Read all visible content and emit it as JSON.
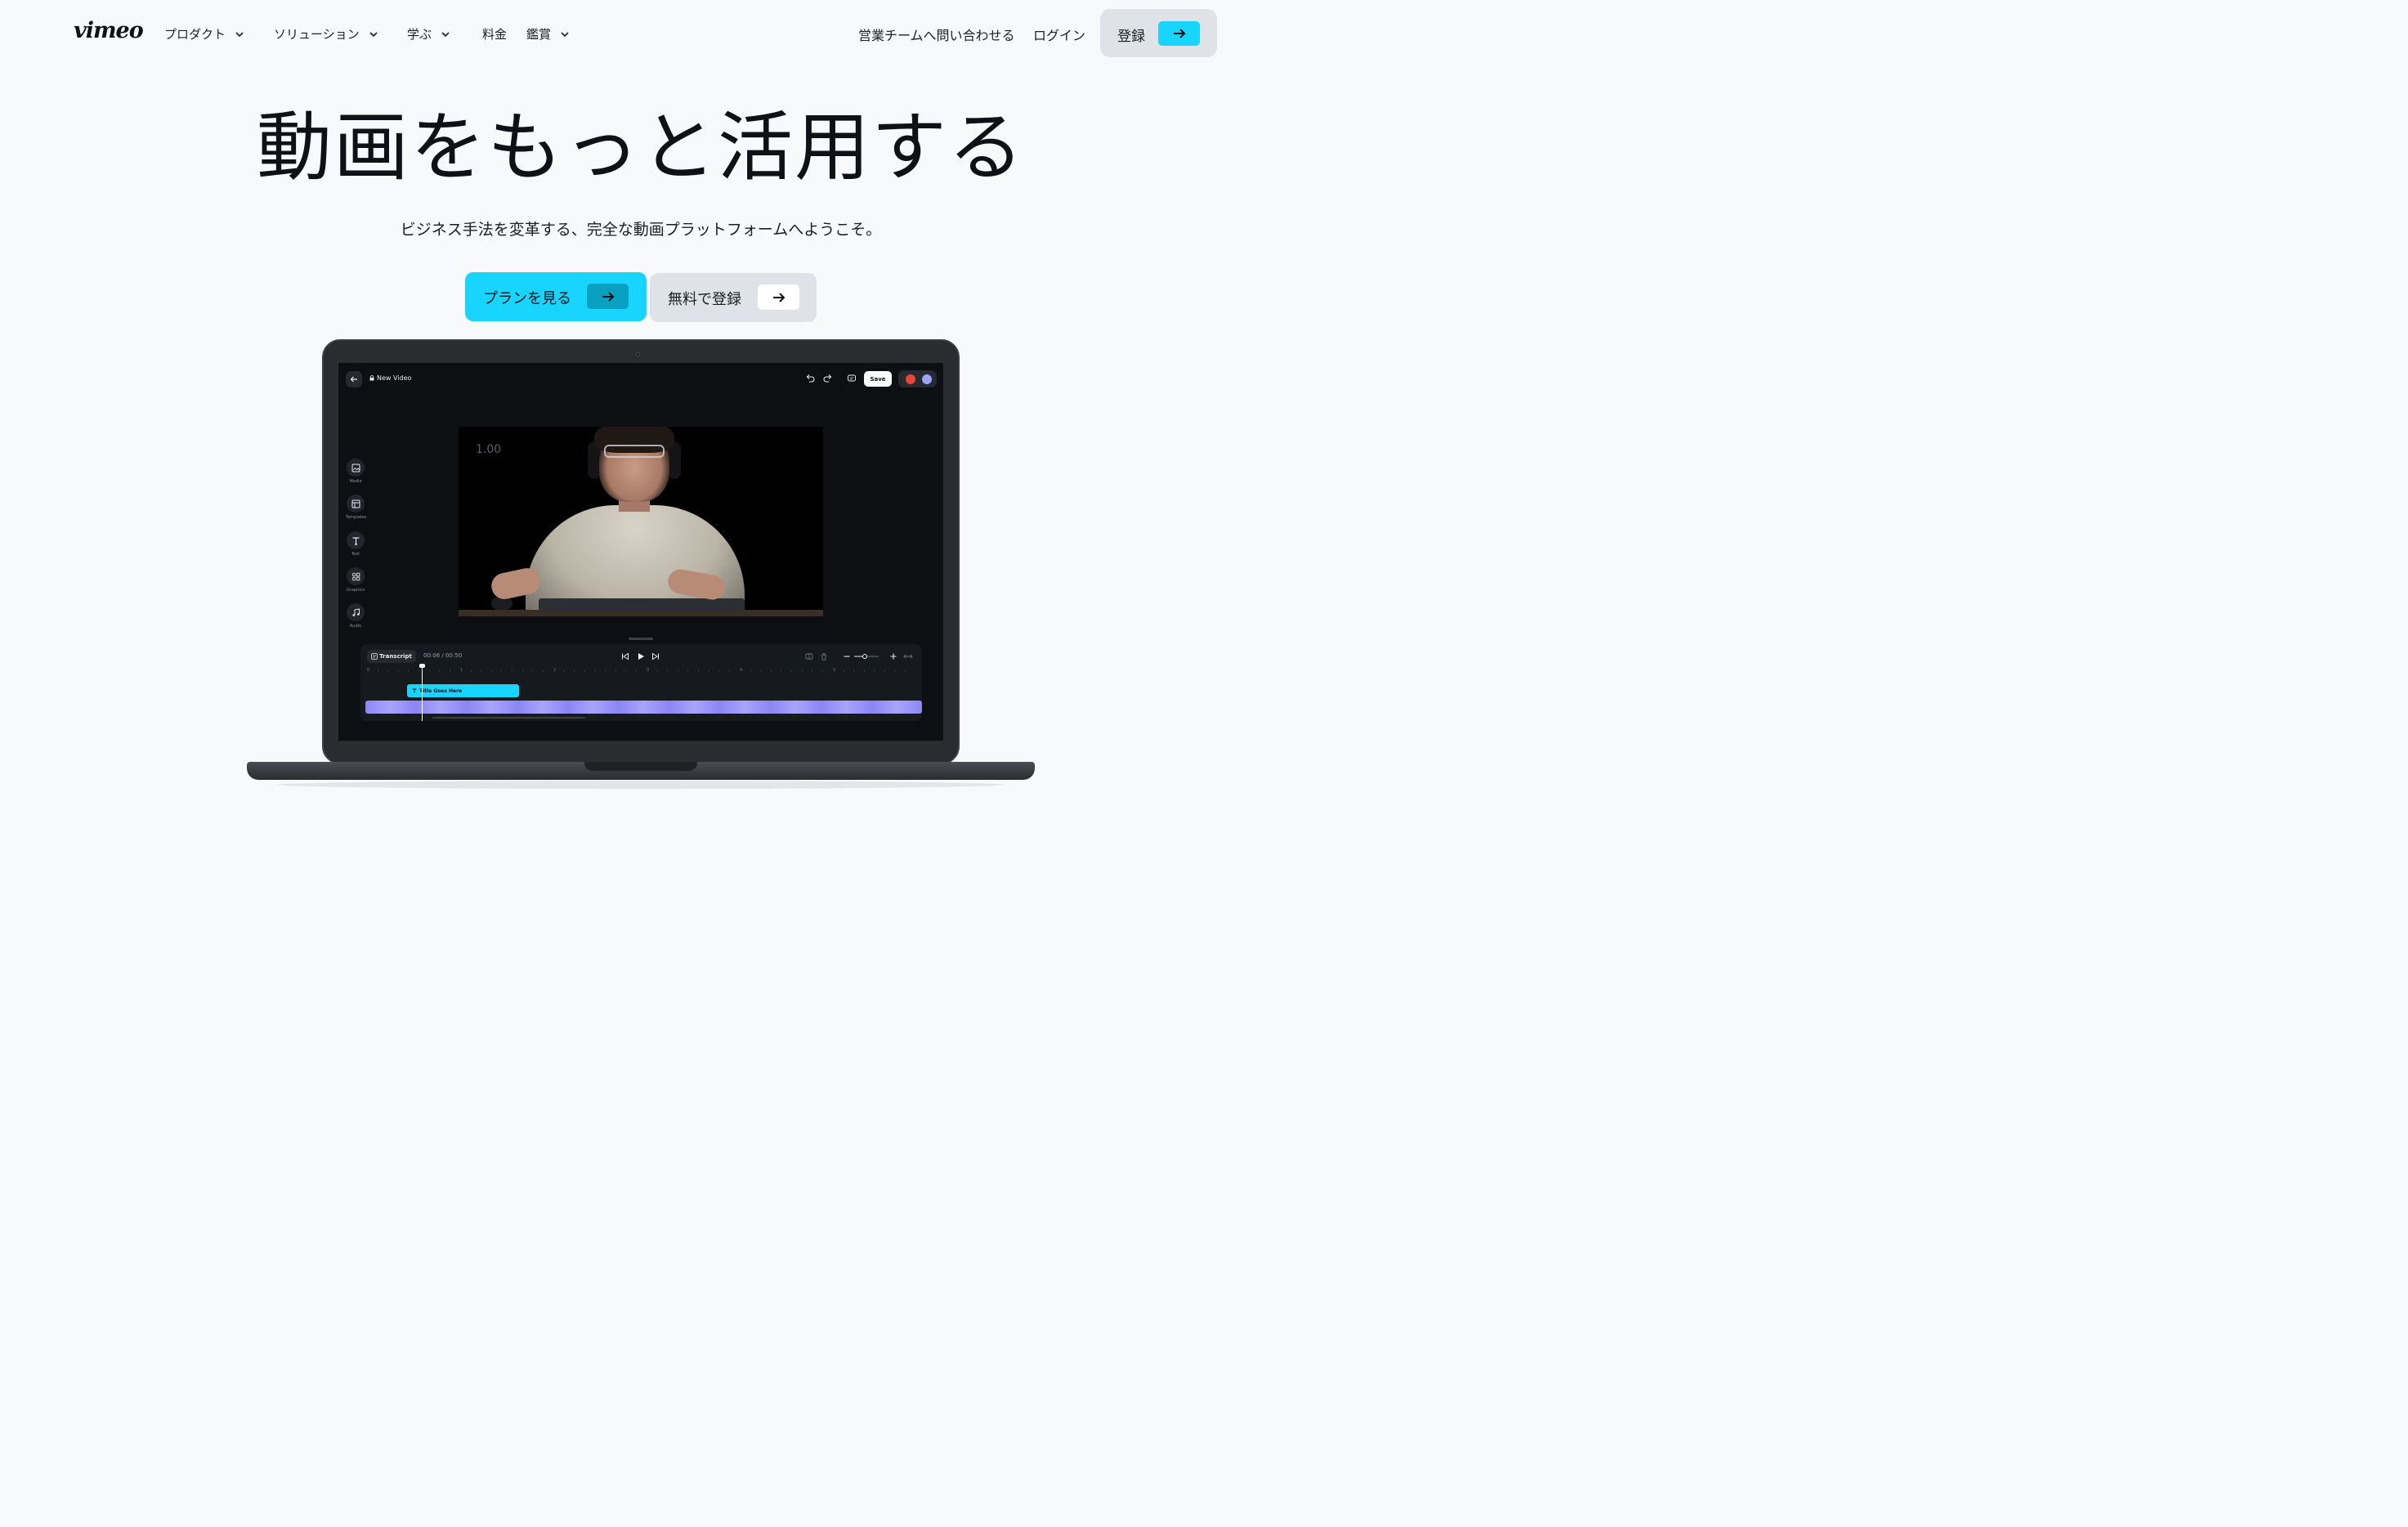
{
  "header": {
    "logo": "vimeo",
    "nav": [
      {
        "label": "プロダクト",
        "has_dropdown": true
      },
      {
        "label": "ソリューション",
        "has_dropdown": true
      },
      {
        "label": "学ぶ",
        "has_dropdown": true
      },
      {
        "label": "料金",
        "has_dropdown": false
      },
      {
        "label": "鑑賞",
        "has_dropdown": true
      }
    ],
    "contact_sales": "営業チームへ問い合わせる",
    "login": "ログイン",
    "signup": "登録"
  },
  "hero": {
    "title": "動画をもっと活用する",
    "subtitle": "ビジネス手法を変革する、完全な動画プラットフォームへようこそ。",
    "primary_cta": "プランを見る",
    "secondary_cta": "無料で登録"
  },
  "editor": {
    "project_title": "New Video",
    "save_label": "Save",
    "tools": [
      {
        "label": "Media",
        "icon": "image-icon"
      },
      {
        "label": "Templates",
        "icon": "layout-icon"
      },
      {
        "label": "Text",
        "icon": "text-icon"
      },
      {
        "label": "Graphics",
        "icon": "shapes-icon"
      },
      {
        "label": "Audio",
        "icon": "music-icon"
      }
    ],
    "video_timestamp": "1.00",
    "timeline": {
      "transcript_label": "Transcript",
      "time": "00:06 / 00:50",
      "ruler": [
        "0",
        "1",
        "2",
        "3",
        "4",
        "5"
      ],
      "text_clip": "Title Goes Here"
    }
  },
  "colors": {
    "accent": "#17d5ff",
    "background": "#f8f9fb",
    "secondary_button": "#dfe3e8",
    "video_track": "#a9a4ff"
  }
}
